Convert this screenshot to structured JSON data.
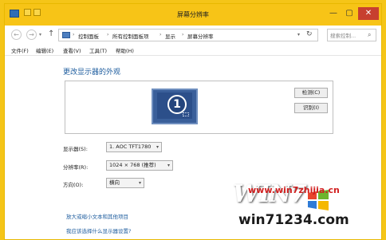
{
  "window": {
    "title": "屏幕分辨率"
  },
  "address": {
    "breadcrumbs": [
      "控制面板",
      "所有控制面板项",
      "显示",
      "屏幕分辨率"
    ],
    "search_placeholder": "搜索控制..."
  },
  "menu": {
    "items": [
      "文件(F)",
      "编辑(E)",
      "查看(V)",
      "工具(T)",
      "帮助(H)"
    ]
  },
  "main": {
    "heading": "更改显示器的外观",
    "monitor_number": "1",
    "detect_button": "检测(C)",
    "identify_button": "识别(I)",
    "display_label": "显示器(S):",
    "display_value": "1. AOC TFT1780",
    "resolution_label": "分辨率(R):",
    "resolution_value": "1024 × 768 (推荐)",
    "orientation_label": "方向(O):",
    "orientation_value": "横向",
    "link1": "放大或缩小文本和其他项目",
    "link2": "我应该选择什么显示器设置?"
  },
  "watermark": {
    "brand": "WIN7",
    "site1": "www.win7zhijia.cn",
    "site2": "win71234.com"
  },
  "colors": {
    "accent": "#1d5c9e",
    "background": "#f5c518",
    "close": "#c7402f"
  }
}
